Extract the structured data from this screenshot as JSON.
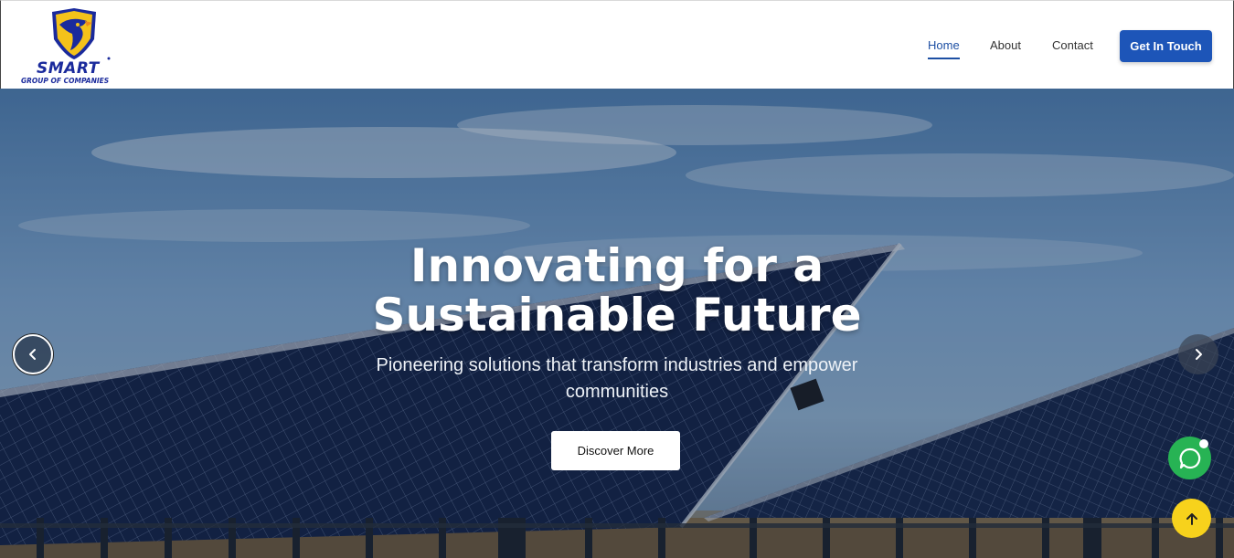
{
  "brand": {
    "name": "SMART",
    "tagline": "GROUP OF COMPANIES",
    "logo_icon": "eagle-shield-icon"
  },
  "nav": {
    "items": [
      {
        "label": "Home",
        "active": true
      },
      {
        "label": "About",
        "active": false
      },
      {
        "label": "Contact",
        "active": false
      }
    ],
    "cta_label": "Get In Touch"
  },
  "hero": {
    "title_line1": "Innovating for a",
    "title_line2": "Sustainable Future",
    "subtitle_line1": "Pioneering solutions that transform industries and empower",
    "subtitle_line2": "communities",
    "button_label": "Discover More",
    "prev_icon": "chevron-left-icon",
    "next_icon": "chevron-right-icon"
  },
  "floating": {
    "chat_icon": "chat-bubble-icon",
    "top_icon": "arrow-up-icon"
  },
  "colors": {
    "accent": "#1d4fa3",
    "cta": "#1d55b8",
    "chat": "#27b354",
    "scroll_top": "#f7d21c",
    "brand_text": "#1a2a9c"
  }
}
